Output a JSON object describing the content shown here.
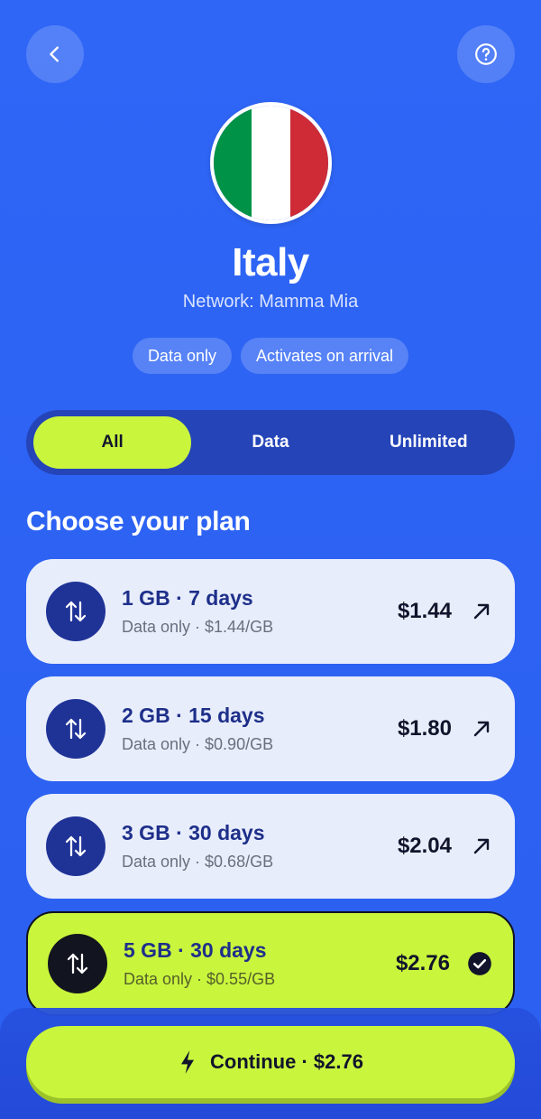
{
  "header": {
    "country": "Italy",
    "network": "Network: Mamma Mia",
    "tags": [
      "Data only",
      "Activates on arrival"
    ]
  },
  "flag": {
    "colors": [
      "#009246",
      "#ffffff",
      "#ce2b37"
    ]
  },
  "tabs": [
    {
      "label": "All",
      "active": true
    },
    {
      "label": "Data",
      "active": false
    },
    {
      "label": "Unlimited",
      "active": false
    }
  ],
  "section_title": "Choose your plan",
  "plans": [
    {
      "title": "1 GB · 7 days",
      "subtitle": "Data only · $1.44/GB",
      "price": "$1.44",
      "selected": false
    },
    {
      "title": "2 GB · 15 days",
      "subtitle": "Data only · $0.90/GB",
      "price": "$1.80",
      "selected": false
    },
    {
      "title": "3 GB · 30 days",
      "subtitle": "Data only · $0.68/GB",
      "price": "$2.04",
      "selected": false
    },
    {
      "title": "5 GB · 30 days",
      "subtitle": "Data only · $0.55/GB",
      "price": "$2.76",
      "selected": true
    }
  ],
  "cta": {
    "label": "Continue · $2.76",
    "icon": "bolt-icon"
  },
  "icons": {
    "back": "chevron-left-icon",
    "help": "help-circle-icon",
    "plan": "swap-arrows-icon",
    "open": "arrow-up-right-icon",
    "selected": "check-circle-icon"
  },
  "colors": {
    "background": "#2f66f6",
    "accent": "#c9f53d",
    "card": "#e8edfb",
    "plan_icon_bg": "#1f3397",
    "title_text": "#1e2f8a"
  }
}
